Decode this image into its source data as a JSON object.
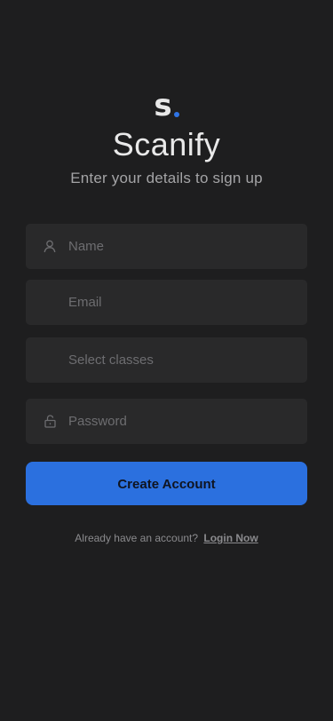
{
  "app": {
    "name": "Scanify",
    "logo_letter": "s",
    "accent_color": "#2f74e6"
  },
  "header": {
    "subtitle": "Enter your details to sign up"
  },
  "form": {
    "name": {
      "placeholder": "Name",
      "value": "",
      "icon": "user-icon"
    },
    "email": {
      "placeholder": "Email",
      "value": ""
    },
    "classes": {
      "placeholder": "Select classes",
      "value": ""
    },
    "password": {
      "placeholder": "Password",
      "value": "",
      "icon": "lock-icon"
    },
    "submit_label": "Create Account"
  },
  "footer": {
    "prompt": "Already have an account?",
    "link_label": "Login Now"
  }
}
